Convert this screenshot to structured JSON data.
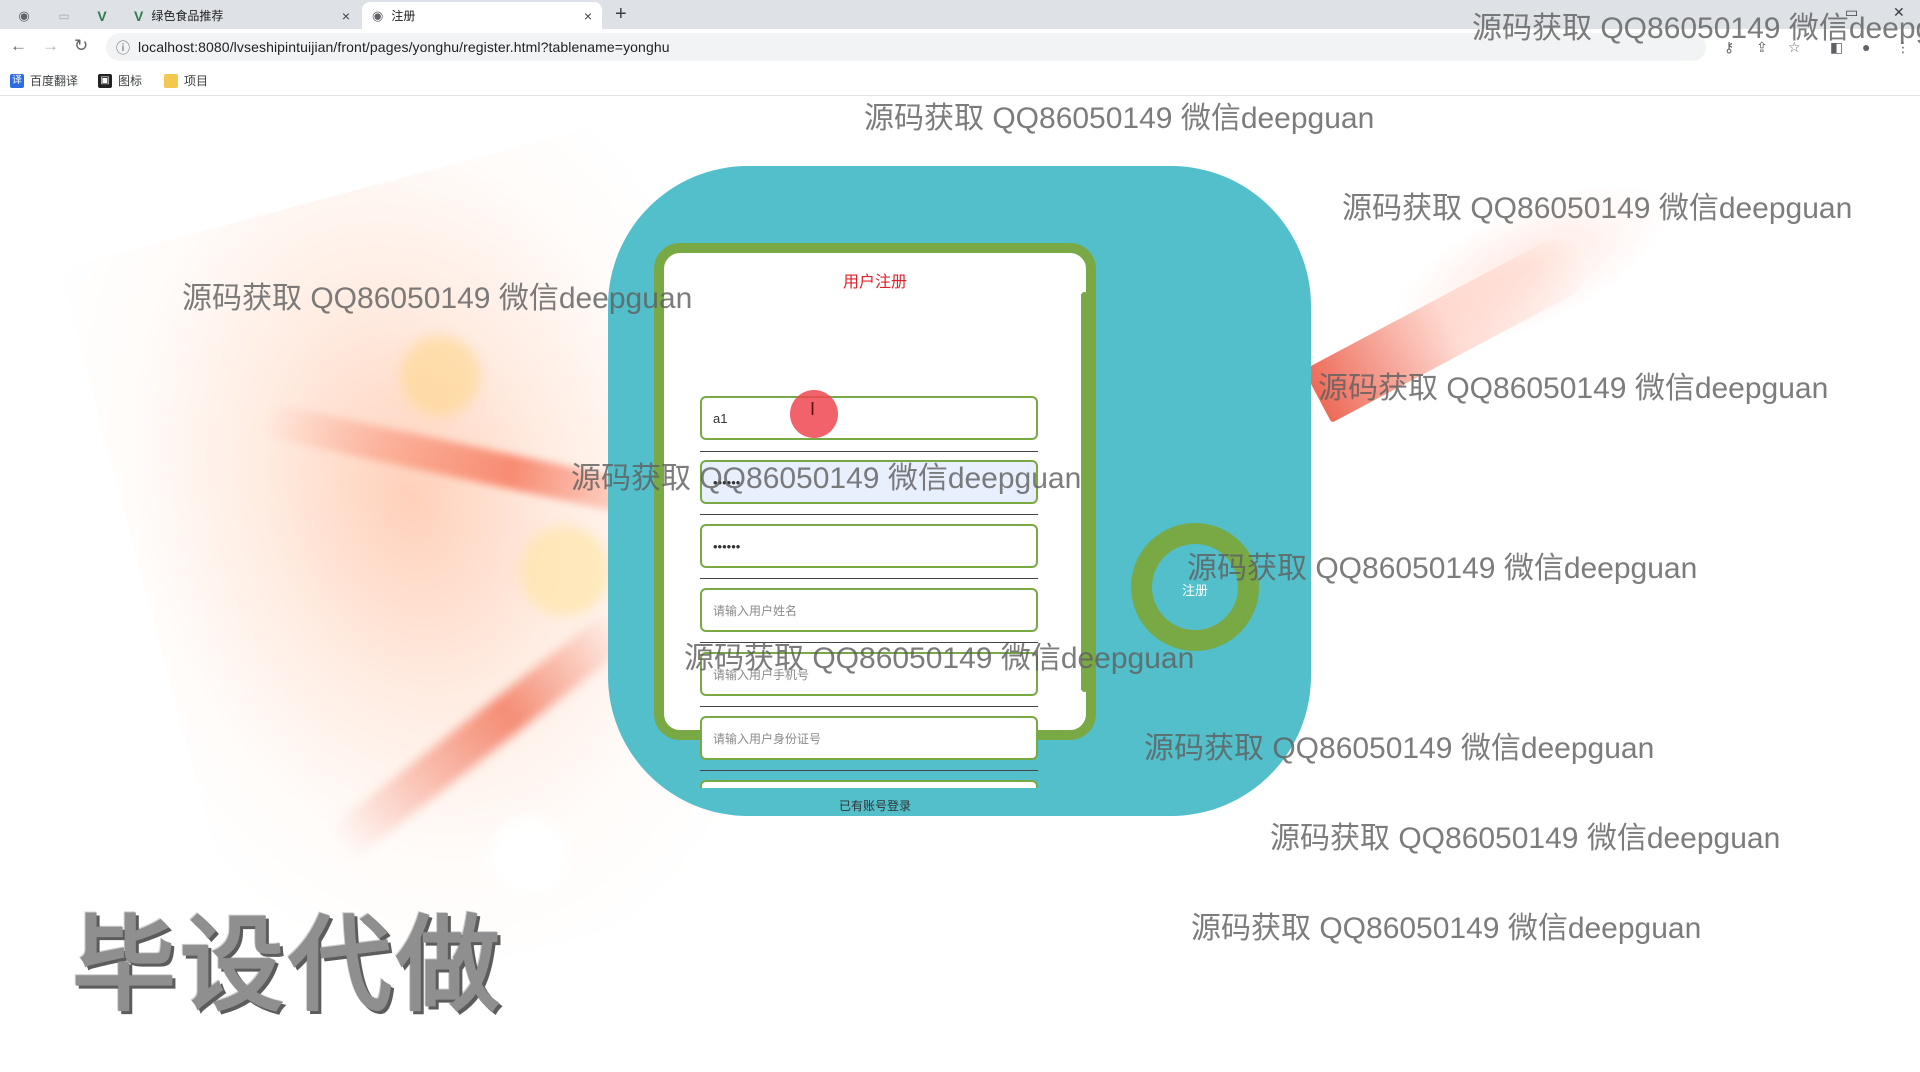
{
  "browser": {
    "tabs": [
      {
        "label": "",
        "icon": "globe-icon"
      },
      {
        "label": "",
        "icon": "blank-page-icon"
      },
      {
        "label": "",
        "icon": "vue-icon"
      },
      {
        "label": "绿色食品推荐",
        "icon": "vue-icon"
      },
      {
        "label": "注册",
        "icon": "globe-icon",
        "active": true
      }
    ],
    "new_tab": "+",
    "url": "localhost:8080/lvseshipintuijian/front/pages/yonghu/register.html?tablename=yonghu",
    "bookmarks": [
      {
        "label": "百度翻译",
        "icon": "translate-icon"
      },
      {
        "label": "图标",
        "icon": "image-icon"
      },
      {
        "label": "项目",
        "icon": "folder-icon"
      }
    ]
  },
  "form": {
    "title": "用户注册",
    "account_value": "a1",
    "password_value": "••••••",
    "confirm_password_value": "••••••",
    "name_placeholder": "请输入用户姓名",
    "phone_placeholder": "请输入用户手机号",
    "idcard_placeholder": "请输入用户身份证号",
    "login_link": "已有账号登录",
    "register_button": "注册"
  },
  "watermark": {
    "text": "源码获取 QQ86050149 微信deepguan",
    "banner": "毕设代做"
  },
  "colors": {
    "teal": "#52bfcb",
    "green": "#79a944",
    "title_red": "#e0202a"
  }
}
